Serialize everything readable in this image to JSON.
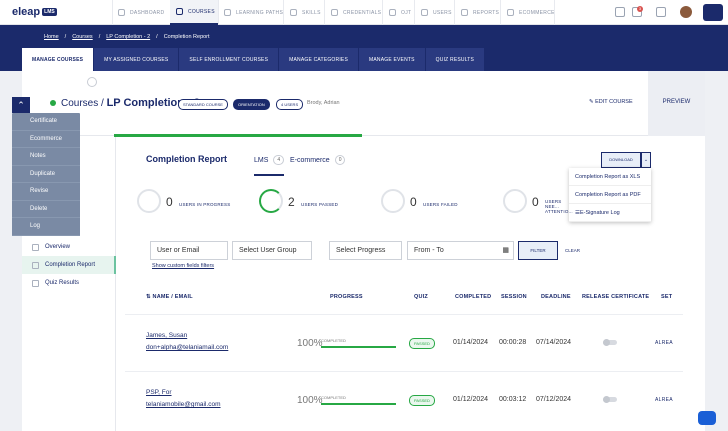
{
  "brand": {
    "name": "eleap",
    "tag": "LMS"
  },
  "topnav": {
    "items": [
      {
        "label": "DASHBOARD",
        "icon": "home-icon"
      },
      {
        "label": "COURSES",
        "icon": "book-icon",
        "active": true
      },
      {
        "label": "LEARNING PATHS",
        "icon": "path-icon"
      },
      {
        "label": "SKILLS",
        "icon": "star-icon"
      },
      {
        "label": "CREDENTIALS",
        "icon": "certificate-icon"
      },
      {
        "label": "OJT",
        "icon": "badge-icon"
      },
      {
        "label": "USERS",
        "icon": "users-icon"
      },
      {
        "label": "REPORTS",
        "icon": "report-icon"
      },
      {
        "label": "ECOMMERCE",
        "icon": "cart-icon"
      }
    ],
    "notif_count": "3"
  },
  "breadcrumb": {
    "home": "Home",
    "courses": "Courses",
    "course": "LP Completion - 2",
    "current": "Completion Report"
  },
  "tabs": [
    "MANAGE COURSES",
    "MY ASSIGNED COURSES",
    "SELF ENROLLMENT COURSES",
    "MANAGE CATEGORIES",
    "MANAGE EVENTS",
    "QUIZ RESULTS"
  ],
  "header": {
    "prefix": "Courses /",
    "course": "LP Completion - 2",
    "chips": [
      "STANDARD COURSE",
      "ORIENTATION",
      "4 USERS"
    ],
    "owner": "Brody, Adrian",
    "edit": "EDIT COURSE",
    "preview": "PREVIEW"
  },
  "dropdown": [
    "Certificate",
    "Ecommerce",
    "Notes",
    "Duplicate",
    "Revise",
    "Delete",
    "Log"
  ],
  "leftnav": [
    {
      "label": "Overview",
      "icon": "grid-icon"
    },
    {
      "label": "Completion Report",
      "icon": "report-icon",
      "active": true
    },
    {
      "label": "Quiz Results",
      "icon": "quiz-icon"
    }
  ],
  "report": {
    "title": "Completion Report",
    "lms_tab": "LMS",
    "lms_count": "4",
    "ecom_tab": "E-commerce",
    "ecom_count": "0",
    "download": "DOWNLOAD",
    "download_menu": [
      "Completion Report as XLS",
      "Completion Report as PDF",
      "E-Signature Log"
    ]
  },
  "stats": [
    {
      "num": "0",
      "label": "USERS IN PROGRESS"
    },
    {
      "num": "2",
      "label": "USERS PASSED"
    },
    {
      "num": "0",
      "label": "USERS FAILED"
    },
    {
      "num": "0",
      "label": "USERS NEE... ATTENTIO..."
    }
  ],
  "filters": {
    "user": "User or Email",
    "group": "Select User Group",
    "progress": "Select Progress",
    "date": "From - To",
    "filter_btn": "FILTER",
    "clear": "CLEAR",
    "custom": "Show custom fields filters"
  },
  "columns": [
    "NAME / EMAIL",
    "PROGRESS",
    "QUIZ",
    "COMPLETED",
    "SESSION",
    "DEADLINE",
    "RELEASE CERTIFICATE",
    "SET"
  ],
  "rows": [
    {
      "name": "James, Susan",
      "email": "don+alpha@telaniamail.com",
      "pct": "100%",
      "plabel": "COMPLETED",
      "quiz": "PASSED",
      "completed": "01/14/2024",
      "session": "00:00:28",
      "deadline": "07/14/2024",
      "set": "ALREA"
    },
    {
      "name": "PSP, For",
      "email": "telaniamobile@gmail.com",
      "pct": "100%",
      "plabel": "COMPLETED",
      "quiz": "PASSED",
      "completed": "01/12/2024",
      "session": "00:03:12",
      "deadline": "07/12/2024",
      "set": "ALREA"
    }
  ]
}
